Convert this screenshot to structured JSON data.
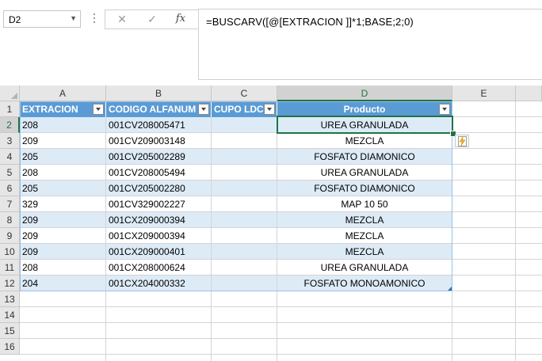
{
  "name_box": {
    "value": "D2"
  },
  "formula_bar": {
    "cancel_icon": "✕",
    "enter_icon": "✓",
    "fx_label": "fx",
    "formula": "=BUSCARV([@[EXTRACION ]]*1;BASE;2;0)"
  },
  "columns": [
    "A",
    "B",
    "C",
    "D",
    "E"
  ],
  "row_numbers": [
    "1",
    "2",
    "3",
    "4",
    "5",
    "6",
    "7",
    "8",
    "9",
    "10",
    "11",
    "12",
    "13",
    "14",
    "15",
    "16"
  ],
  "table": {
    "headers": [
      "EXTRACION",
      "CODIGO ALFANUM",
      "CUPO LDC",
      "Producto"
    ],
    "rows": [
      [
        "208",
        "001CV208005471",
        "",
        "UREA GRANULADA"
      ],
      [
        "209",
        "001CV209003148",
        "",
        "MEZCLA"
      ],
      [
        "205",
        "001CV205002289",
        "",
        "FOSFATO DIAMONICO"
      ],
      [
        "208",
        "001CV208005494",
        "",
        "UREA GRANULADA"
      ],
      [
        "205",
        "001CV205002280",
        "",
        "FOSFATO DIAMONICO"
      ],
      [
        "329",
        "001CV329002227",
        "",
        "MAP 10 50"
      ],
      [
        "209",
        "001CX209000394",
        "",
        "MEZCLA"
      ],
      [
        "209",
        "001CX209000394",
        "",
        "MEZCLA"
      ],
      [
        "209",
        "001CX209000401",
        "",
        "MEZCLA"
      ],
      [
        "208",
        "001CX208000624",
        "",
        "UREA GRANULADA"
      ],
      [
        "204",
        "001CX204000332",
        "",
        "FOSFATO MONOAMONICO"
      ]
    ]
  },
  "colors": {
    "table_header": "#5b9bd5",
    "band": "#ddebf7",
    "selection": "#217346"
  }
}
